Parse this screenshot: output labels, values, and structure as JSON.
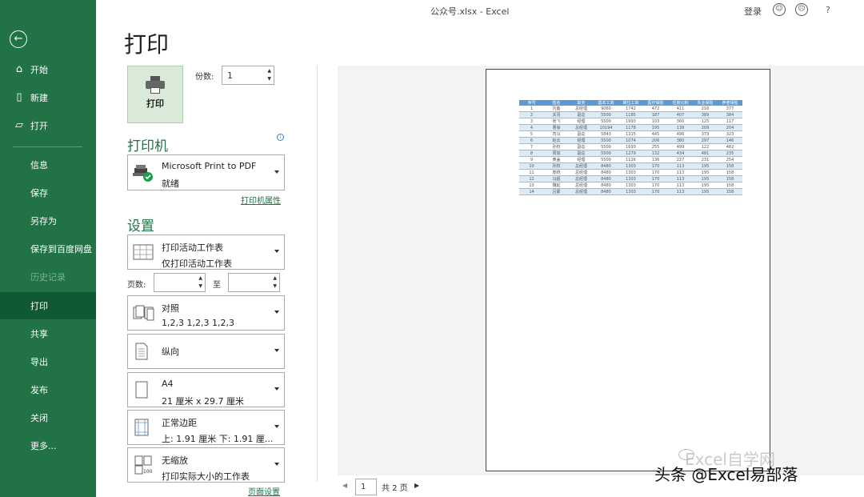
{
  "window": {
    "title": "公众号.xlsx  -  Excel",
    "login": "登录",
    "help": "?"
  },
  "sidebar": {
    "items": [
      {
        "label": "开始",
        "icon": "home-icon"
      },
      {
        "label": "新建",
        "icon": "new-file-icon"
      },
      {
        "label": "打开",
        "icon": "folder-open-icon"
      },
      {
        "label": "信息"
      },
      {
        "label": "保存"
      },
      {
        "label": "另存为"
      },
      {
        "label": "保存到百度网盘"
      },
      {
        "label": "历史记录",
        "disabled": true
      },
      {
        "label": "打印",
        "active": true
      },
      {
        "label": "共享"
      },
      {
        "label": "导出"
      },
      {
        "label": "发布"
      },
      {
        "label": "关闭"
      },
      {
        "label": "更多..."
      }
    ]
  },
  "main": {
    "title": "打印",
    "print_button": "打印",
    "copies_label": "份数:",
    "copies_value": "1",
    "printer": {
      "heading": "打印机",
      "name": "Microsoft Print to PDF",
      "status": "就绪",
      "properties_link": "打印机属性"
    },
    "settings": {
      "heading": "设置",
      "scope": {
        "line1": "打印活动工作表",
        "line2": "仅打印活动工作表"
      },
      "pages_label": "页数:",
      "to_label": "至",
      "collate": {
        "line1": "对照",
        "line2": "1,2,3    1,2,3    1,2,3"
      },
      "orientation": {
        "line1": "纵向"
      },
      "paper": {
        "line1": "A4",
        "line2": "21 厘米 x 29.7 厘米"
      },
      "margins": {
        "line1": "正常边距",
        "line2": "上: 1.91 厘米 下: 1.91 厘..."
      },
      "scaling": {
        "line1": "无缩放",
        "line2": "打印实际大小的工作表"
      },
      "page_setup_link": "页面设置"
    }
  },
  "preview": {
    "current_page": "1",
    "total_pages": "共 2 页",
    "sheet": {
      "headers": [
        "序号",
        "姓名",
        "职务",
        "基本工资",
        "岗位工资",
        "医疗保险",
        "住房公积",
        "失业保险",
        "养老保险"
      ],
      "rows": [
        [
          "1",
          "刘备",
          "总经理",
          "9060",
          "1742",
          "472",
          "411",
          "216",
          "377"
        ],
        [
          "2",
          "关羽",
          "副总",
          "5500",
          "1185",
          "187",
          "407",
          "389",
          "384"
        ],
        [
          "3",
          "张飞",
          "经理",
          "5500",
          "1993",
          "103",
          "360",
          "125",
          "117"
        ],
        [
          "4",
          "曹操",
          "总经理",
          "10194",
          "1178",
          "195",
          "139",
          "209",
          "204"
        ],
        [
          "5",
          "司马",
          "副总",
          "5843",
          "1315",
          "445",
          "496",
          "379",
          "323"
        ],
        [
          "6",
          "赵云",
          "经理",
          "5500",
          "1074",
          "206",
          "380",
          "297",
          "146"
        ],
        [
          "7",
          "孙权",
          "副总",
          "5500",
          "1693",
          "255",
          "499",
          "122",
          "482"
        ],
        [
          "8",
          "周瑜",
          "副总",
          "5500",
          "1279",
          "132",
          "434",
          "481",
          "235"
        ],
        [
          "9",
          "黄盖",
          "经理",
          "5500",
          "1126",
          "136",
          "227",
          "231",
          "254"
        ],
        [
          "10",
          "孙权",
          "总经理",
          "8480",
          "1303",
          "170",
          "113",
          "195",
          "158"
        ],
        [
          "11",
          "庞统",
          "总经理",
          "8480",
          "1303",
          "170",
          "113",
          "195",
          "158"
        ],
        [
          "12",
          "马超",
          "总经理",
          "8480",
          "1303",
          "170",
          "113",
          "195",
          "158"
        ],
        [
          "13",
          "魏延",
          "总经理",
          "8480",
          "1303",
          "170",
          "113",
          "195",
          "158"
        ],
        [
          "14",
          "吕蒙",
          "总经理",
          "8480",
          "1303",
          "170",
          "113",
          "195",
          "158"
        ]
      ]
    }
  },
  "watermark": {
    "line1": "Excel自学网",
    "line2": "头条 @Excel易部落"
  }
}
